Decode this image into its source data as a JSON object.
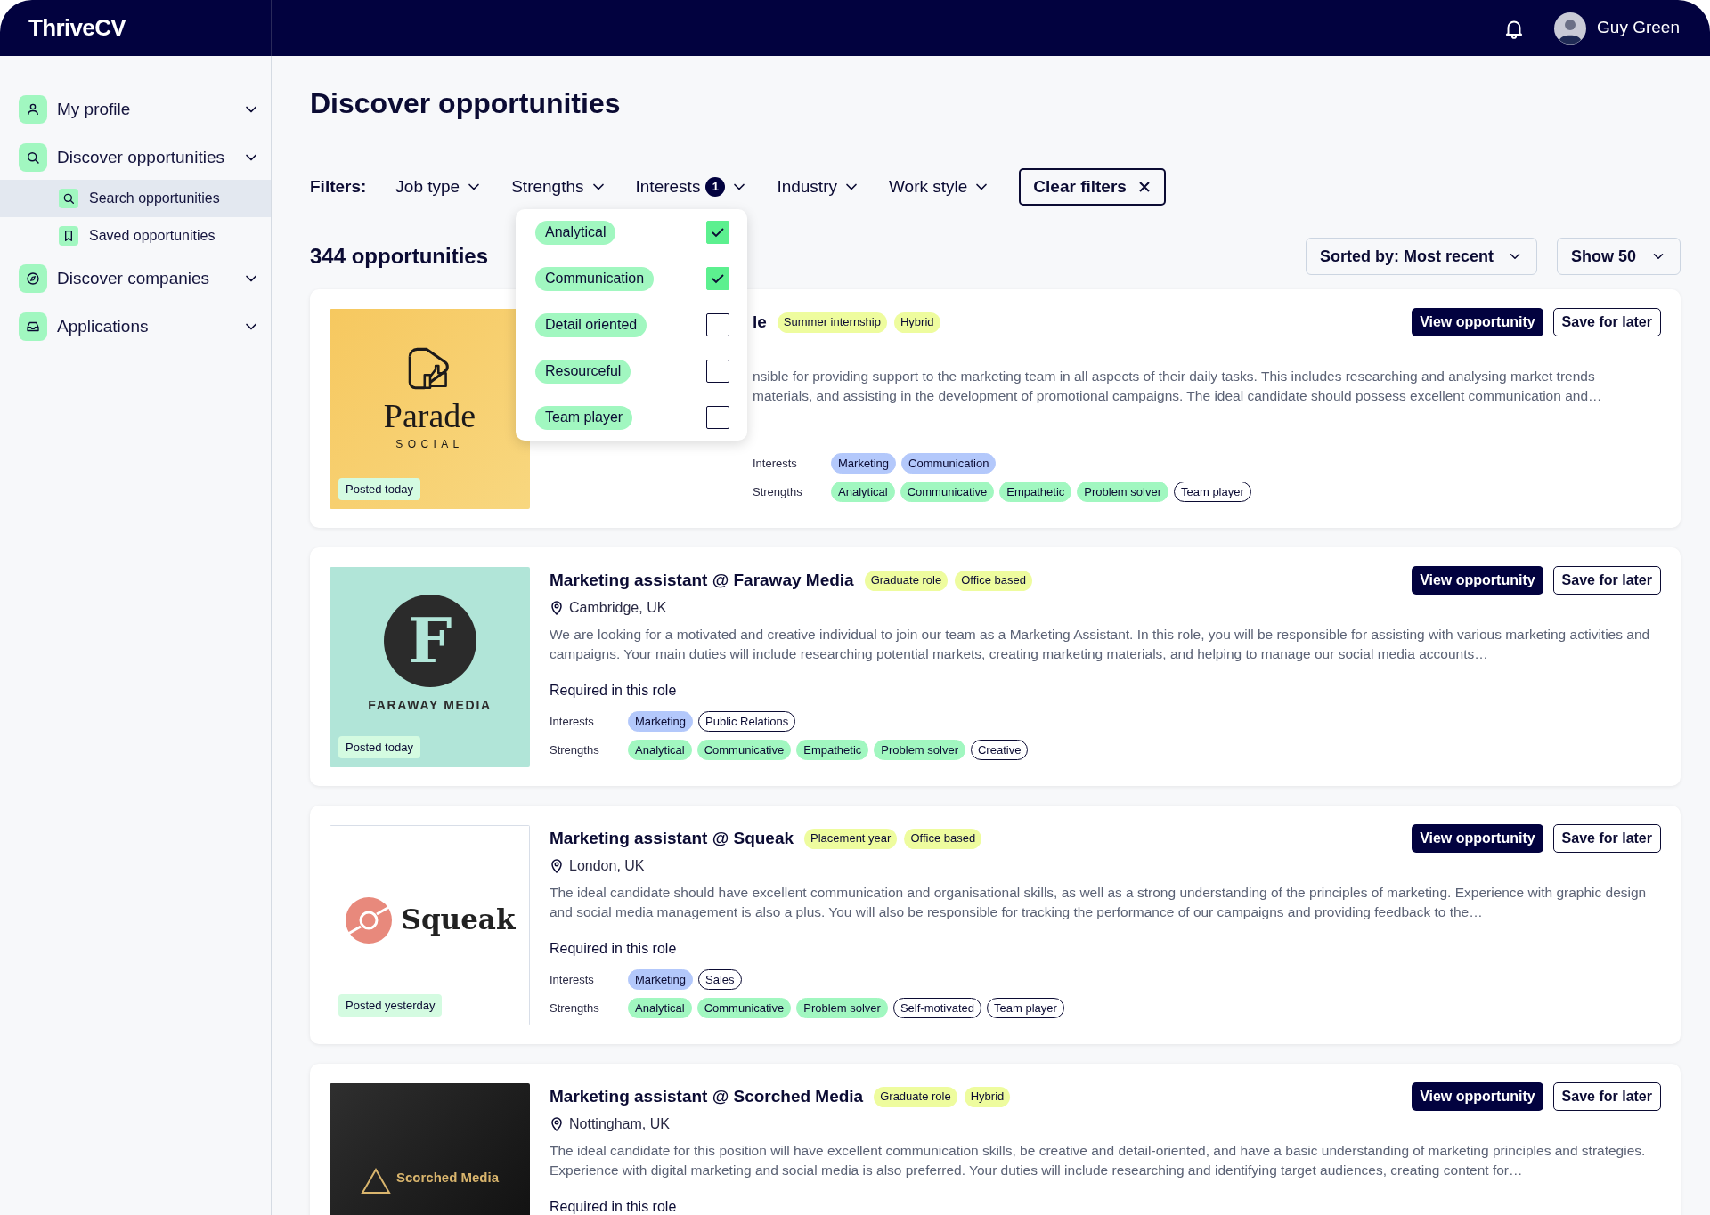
{
  "brand": "ThriveCV",
  "user": {
    "name": "Guy Green"
  },
  "sidebar": {
    "items": [
      {
        "label": "My profile"
      },
      {
        "label": "Discover opportunities",
        "children": [
          {
            "label": "Search opportunities",
            "selected": true
          },
          {
            "label": "Saved opportunities",
            "selected": false
          }
        ]
      },
      {
        "label": "Discover companies"
      },
      {
        "label": "Applications"
      }
    ]
  },
  "page_title": "Discover opportunities",
  "filters": {
    "label": "Filters:",
    "items": [
      {
        "label": "Job type"
      },
      {
        "label": "Strengths"
      },
      {
        "label": "Interests",
        "count": "1"
      },
      {
        "label": "Industry"
      },
      {
        "label": "Work style"
      }
    ],
    "clear": "Clear filters"
  },
  "dropdown": {
    "options": [
      {
        "label": "Analytical",
        "checked": true
      },
      {
        "label": "Communication",
        "checked": true
      },
      {
        "label": "Detail oriented",
        "checked": false
      },
      {
        "label": "Resourceful",
        "checked": false
      },
      {
        "label": "Team player",
        "checked": false
      }
    ]
  },
  "result_count": "344 opportunities",
  "sort": "Sorted by: Most recent",
  "page_size": "Show 50",
  "cards": [
    {
      "covered": true,
      "logo": {
        "kind": "parade",
        "name": "Parade",
        "sub": "SOCIAL"
      },
      "posted": "Posted today",
      "title": "le",
      "tags": [
        "Summer internship",
        "Hybrid"
      ],
      "description": [
        "nsible for providing support to the marketing team in all aspects of their daily tasks. This includes researching and analysing market trends",
        "materials, and assisting in the development of promotional campaigns. The ideal candidate should possess excellent communication and…"
      ],
      "interests_label": "Interests",
      "interests": [
        {
          "label": "Marketing",
          "matched": true
        },
        {
          "label": "Communication",
          "matched": true
        }
      ],
      "strengths_label": "Strengths",
      "strengths": [
        {
          "label": "Analytical",
          "matched": true
        },
        {
          "label": "Communicative",
          "matched": true
        },
        {
          "label": "Empathetic",
          "matched": true
        },
        {
          "label": "Problem solver",
          "matched": true
        },
        {
          "label": "Team player",
          "matched": false
        }
      ],
      "view": "View opportunity",
      "save": "Save for later"
    },
    {
      "covered": false,
      "logo": {
        "kind": "faraway",
        "name": "FARAWAY MEDIA",
        "mark": "F"
      },
      "posted": "Posted today",
      "title": "Marketing assistant @ Faraway Media",
      "tags": [
        "Graduate role",
        "Office based"
      ],
      "location": "Cambridge, UK",
      "description": [
        "We are looking for a motivated and creative individual to join our team as a Marketing Assistant. In this role, you will be responsible for assisting with various marketing activities and campaigns. Your main duties will include researching potential markets, creating marketing materials, and helping to manage our social media accounts…"
      ],
      "required": "Required in this role",
      "interests_label": "Interests",
      "interests": [
        {
          "label": "Marketing",
          "matched": true
        },
        {
          "label": "Public Relations",
          "matched": false
        }
      ],
      "strengths_label": "Strengths",
      "strengths": [
        {
          "label": "Analytical",
          "matched": true
        },
        {
          "label": "Communicative",
          "matched": true
        },
        {
          "label": "Empathetic",
          "matched": true
        },
        {
          "label": "Problem solver",
          "matched": true
        },
        {
          "label": "Creative",
          "matched": false
        }
      ],
      "view": "View opportunity",
      "save": "Save for later"
    },
    {
      "covered": false,
      "logo": {
        "kind": "squeak",
        "name": "Squeak"
      },
      "posted": "Posted yesterday",
      "title": "Marketing assistant @ Squeak",
      "tags": [
        "Placement year",
        "Office based"
      ],
      "location": "London, UK",
      "description": [
        "The ideal candidate should have excellent communication and organisational skills, as well as a strong understanding of the principles of marketing. Experience with graphic design and social media management is also a plus. You will also be responsible for tracking the performance of our campaigns and providing feedback to the…"
      ],
      "required": "Required in this role",
      "interests_label": "Interests",
      "interests": [
        {
          "label": "Marketing",
          "matched": true
        },
        {
          "label": "Sales",
          "matched": false
        }
      ],
      "strengths_label": "Strengths",
      "strengths": [
        {
          "label": "Analytical",
          "matched": true
        },
        {
          "label": "Communicative",
          "matched": true
        },
        {
          "label": "Problem solver",
          "matched": true
        },
        {
          "label": "Self-motivated",
          "matched": false
        },
        {
          "label": "Team player",
          "matched": false
        }
      ],
      "view": "View opportunity",
      "save": "Save for later"
    },
    {
      "covered": false,
      "logo": {
        "kind": "scorched",
        "name": "Scorched Media"
      },
      "title": "Marketing assistant @ Scorched Media",
      "tags": [
        "Graduate role",
        "Hybrid"
      ],
      "location": "Nottingham, UK",
      "description": [
        "The ideal candidate for this position will have excellent communication skills, be creative and detail-oriented, and have a basic understanding of marketing principles and strategies. Experience with digital marketing and social media is also preferred. Your duties will include researching and identifying target audiences, creating content for…"
      ],
      "required": "Required in this role",
      "view": "View opportunity",
      "save": "Save for later"
    }
  ]
}
